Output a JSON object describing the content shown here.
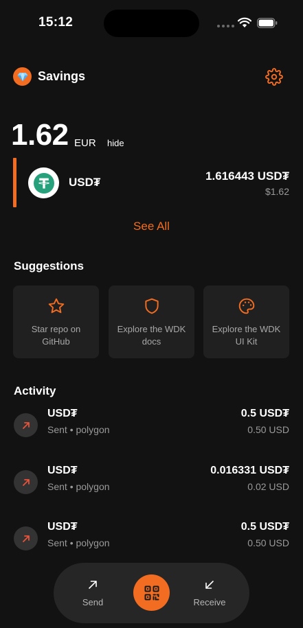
{
  "status_bar": {
    "time": "15:12"
  },
  "header": {
    "wallet_name": "Savings"
  },
  "balance": {
    "amount": "1.62",
    "currency": "EUR",
    "hide_label": "hide"
  },
  "token": {
    "name": "USD₮",
    "amount": "1.616443 USD₮",
    "fiat": "$1.62"
  },
  "see_all": "See All",
  "suggestions": {
    "title": "Suggestions",
    "items": [
      {
        "label": "Star repo on GitHub",
        "icon": "star-icon"
      },
      {
        "label": "Explore the WDK docs",
        "icon": "shield-icon"
      },
      {
        "label": "Explore the WDK UI Kit",
        "icon": "palette-icon"
      }
    ]
  },
  "activity": {
    "title": "Activity",
    "items": [
      {
        "token": "USD₮",
        "sub": "Sent • polygon",
        "amount": "0.5 USD₮",
        "fiat": "0.50 USD"
      },
      {
        "token": "USD₮",
        "sub": "Sent • polygon",
        "amount": "0.016331 USD₮",
        "fiat": "0.02 USD"
      },
      {
        "token": "USD₮",
        "sub": "Sent • polygon",
        "amount": "0.5 USD₮",
        "fiat": "0.50 USD"
      }
    ]
  },
  "actions": {
    "send": "Send",
    "receive": "Receive"
  },
  "colors": {
    "accent": "#f26d21",
    "background": "#121212",
    "card": "#202020",
    "tether": "#26a17b"
  }
}
